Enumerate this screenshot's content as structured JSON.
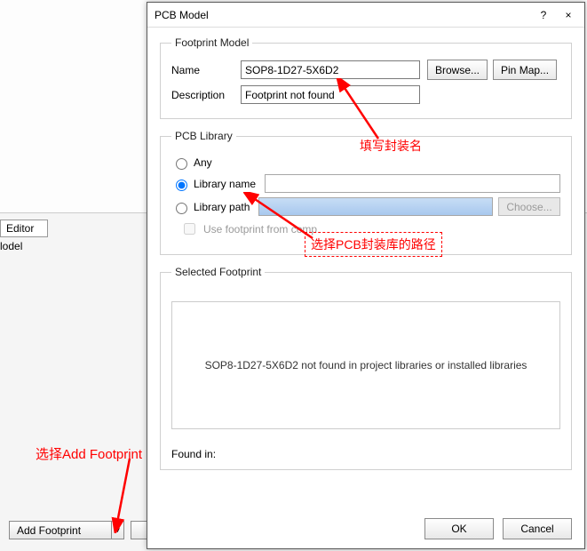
{
  "background": {
    "tab_editor": "Editor",
    "label_model_fragment": "lodel",
    "add_footprint_btn": "Add Footprint"
  },
  "dialog": {
    "title": "PCB Model",
    "help_icon": "?",
    "close_icon": "×",
    "group_footprint": {
      "legend": "Footprint Model",
      "name_label": "Name",
      "name_value": "SOP8-1D27-5X6D2",
      "browse_btn": "Browse...",
      "pinmap_btn": "Pin Map...",
      "desc_label": "Description",
      "desc_value": "Footprint not found"
    },
    "group_library": {
      "legend": "PCB Library",
      "opt_any": "Any",
      "opt_libname": "Library name",
      "opt_libpath": "Library path",
      "choose_btn": "Choose...",
      "use_fp_from_comp": "Use footprint from comp"
    },
    "group_selected": {
      "legend": "Selected Footprint",
      "notfound_msg": "SOP8-1D27-5X6D2 not found in project libraries or installed libraries",
      "foundin_label": "Found in:"
    },
    "ok_btn": "OK",
    "cancel_btn": "Cancel"
  },
  "annotations": {
    "fill_name": "填写封装名",
    "choose_path": "选择PCB封装库的路径",
    "choose_add": "选择Add Footprint"
  }
}
